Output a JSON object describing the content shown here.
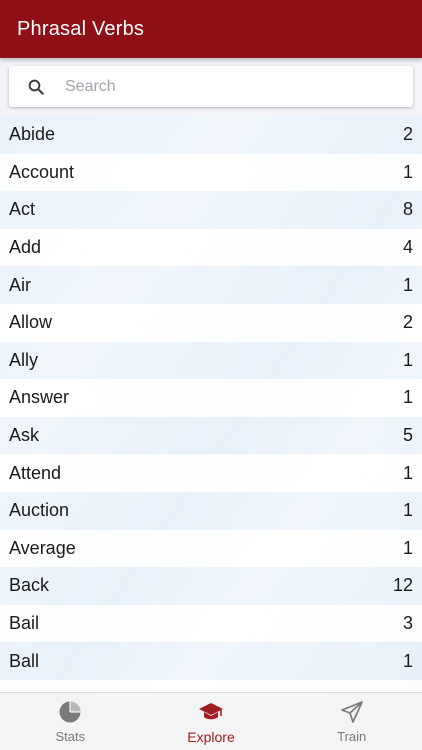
{
  "app": {
    "title": "Phrasal Verbs"
  },
  "search": {
    "placeholder": "Search",
    "value": ""
  },
  "list": {
    "rows": [
      {
        "verb": "Abide",
        "count": "2"
      },
      {
        "verb": "Account",
        "count": "1"
      },
      {
        "verb": "Act",
        "count": "8"
      },
      {
        "verb": "Add",
        "count": "4"
      },
      {
        "verb": "Air",
        "count": "1"
      },
      {
        "verb": "Allow",
        "count": "2"
      },
      {
        "verb": "Ally",
        "count": "1"
      },
      {
        "verb": "Answer",
        "count": "1"
      },
      {
        "verb": "Ask",
        "count": "5"
      },
      {
        "verb": "Attend",
        "count": "1"
      },
      {
        "verb": "Auction",
        "count": "1"
      },
      {
        "verb": "Average",
        "count": "1"
      },
      {
        "verb": "Back",
        "count": "12"
      },
      {
        "verb": "Bail",
        "count": "3"
      },
      {
        "verb": "Ball",
        "count": "1"
      },
      {
        "verb": "",
        "count": ""
      }
    ]
  },
  "tabs": [
    {
      "label": "Stats",
      "icon": "pie-chart-icon",
      "active": false
    },
    {
      "label": "Explore",
      "icon": "graduation-cap-icon",
      "active": true
    },
    {
      "label": "Train",
      "icon": "paper-plane-icon",
      "active": false
    }
  ],
  "colors": {
    "primary": "#8e0f15",
    "active_tab": "#a11c22",
    "inactive_tab": "#7a7a7a"
  }
}
